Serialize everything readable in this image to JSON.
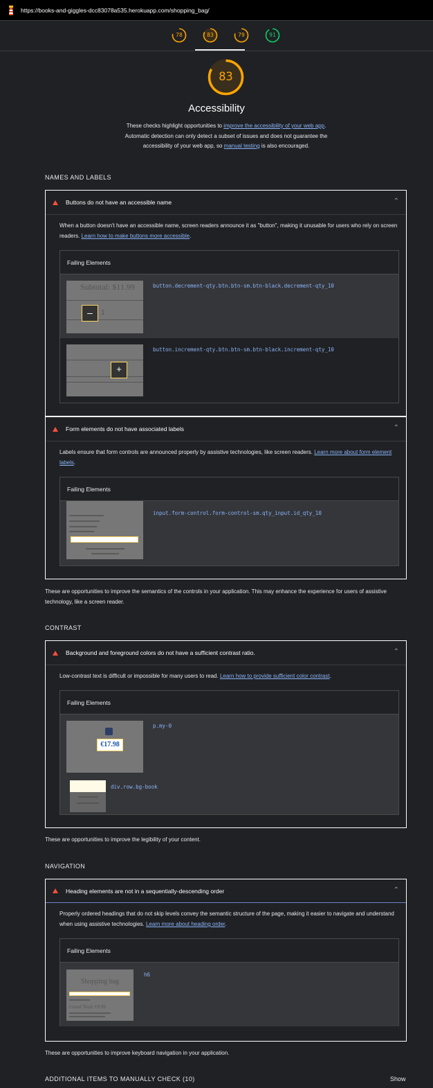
{
  "url": "https://books-and-giggles-dcc83078a535.herokuapp.com/shopping_bag/",
  "scores": [
    "78",
    "83",
    "79",
    "91"
  ],
  "category": {
    "score": "83",
    "title": "Accessibility",
    "desc_1": "These checks highlight opportunities to ",
    "desc_link_1": "improve the accessibility of your web app",
    "desc_2": ". Automatic detection can only detect a subset of issues and does not guarantee the accessibility of your web app, so ",
    "desc_link_2": "manual testing",
    "desc_3": " is also encouraged."
  },
  "colors": {
    "average": "#ffa400",
    "pass": "#0cce6b",
    "fail": "#ff4e42",
    "link": "#8ab4f8"
  },
  "groups": {
    "names": {
      "title": "NAMES AND LABELS",
      "desc": "These are opportunities to improve the semantics of the controls in your application. This may enhance the experience for users of assistive technology, like a screen reader."
    },
    "contrast": {
      "title": "CONTRAST",
      "desc": "These are opportunities to improve the legibility of your content."
    },
    "navigation": {
      "title": "NAVIGATION",
      "desc": "These are opportunities to improve keyboard navigation in your application."
    },
    "manual": {
      "title": "ADDITIONAL ITEMS TO MANUALLY CHECK (10)",
      "show": "Show"
    }
  },
  "failing_label": "Failing Elements",
  "audits": {
    "button_name": {
      "title": "Buttons do not have an accessible name",
      "desc": "When a button doesn't have an accessible name, screen readers announce it as \"button\", making it unusable for users who rely on screen readers. ",
      "link": "Learn how to make buttons more accessible",
      "items": [
        "button.decrement-qty.btn.btn-sm.btn-black.decrement-qty_10",
        "button.increment-qty.btn.btn-sm.btn-black.increment-qty_10"
      ],
      "thumb_text": "Subtotal: $11.99",
      "thumb_qty": "1"
    },
    "label": {
      "title": "Form elements do not have associated labels",
      "desc": "Labels ensure that form controls are announced properly by assistive technologies, like screen readers. ",
      "link": "Learn more about form element labels",
      "items": [
        "input.form-control.form-control-sm.qty_input.id_qty_10"
      ]
    },
    "contrast": {
      "title": "Background and foreground colors do not have a sufficient contrast ratio.",
      "desc": "Low-contrast text is difficult or impossible for many users to read. ",
      "link": "Learn how to provide sufficient color contrast",
      "items": [
        "p.my-0",
        "div.row.bg-book"
      ],
      "thumb_price": "€17.98"
    },
    "heading": {
      "title": "Heading elements are not in a sequentially-descending order",
      "desc": "Properly ordered headings that do not skip levels convey the semantic structure of the page, making it easier to navigate and understand when using assistive technologies. ",
      "link": "Learn more about heading order",
      "items": [
        "h6"
      ],
      "thumb_title": "Shopping bag",
      "thumb_total": "Grand Total: €9.99"
    }
  }
}
